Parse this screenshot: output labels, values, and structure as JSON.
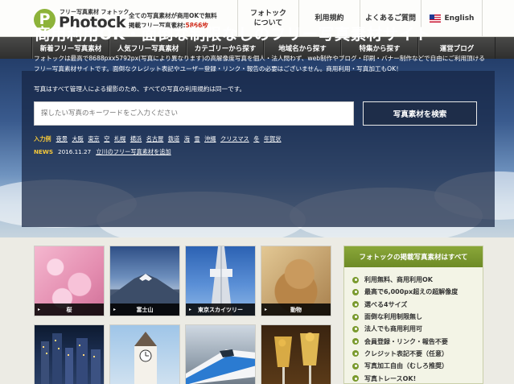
{
  "header": {
    "logo_letter": "P",
    "logo_small": "フリー写真素材 フォトック",
    "logo_word": "Photock",
    "tagline_1": "全ての写真素材が商用OKで無料",
    "tagline_2_prefix": "掲載フリー写真素材:",
    "tagline_2_count": "5866枚",
    "links": [
      {
        "label_1": "フォトック",
        "label_2": "について"
      },
      {
        "label_1": "利用規約",
        "label_2": ""
      },
      {
        "label_1": "よくあるご質問",
        "label_2": ""
      }
    ],
    "language": {
      "label": "English",
      "icon": "us-flag-icon"
    }
  },
  "nav": {
    "items": [
      "新着フリー写真素材",
      "人気フリー写真素材",
      "カテゴリーから探す",
      "地域名から探す",
      "特集から探す",
      "運営ブログ"
    ]
  },
  "hero": {
    "title": "商用利用OK・面倒な制限なしのフリー写真素材サイト",
    "description": "フォトックは最高で8688pxx5792px(写真により異なります)の高解像度写真を個人・法人問わず、web制作やブログ・印刷・バナー制作などで自由にご利用頂けるフリー写真素材サイトです。面倒なクレジット表記やユーザー登録・リンク・報告の必要はございません。商用利用・写真加工もOK！",
    "description_2": "写真はすべて管理人による撮影のため、すべての写真の利用規約は同一です。",
    "search_placeholder": "探したい写真のキーワードをご入力ください",
    "search_button": "写真素材を検索",
    "examples_label": "入力例",
    "examples": [
      "夜景",
      "大阪",
      "東京",
      "空",
      "札幌",
      "横浜",
      "名古屋",
      "鉄道",
      "海",
      "雪",
      "沖縄",
      "クリスマス",
      "冬",
      "年賀状"
    ],
    "news_label": "NEWS",
    "news_date": "2016.11.27",
    "news_text": "立川のフリー写真素材を追加"
  },
  "thumbnails": [
    {
      "caption": "桜"
    },
    {
      "caption": "富士山"
    },
    {
      "caption": "東京スカイツリー"
    },
    {
      "caption": "動物"
    },
    {
      "caption": ""
    },
    {
      "caption": ""
    },
    {
      "caption": ""
    },
    {
      "caption": ""
    }
  ],
  "sidebar": {
    "title": "フォトックの掲載写真素材はすべて",
    "items": [
      "利用無料、商用利用OK",
      "最高で6,000px超えの超解像度",
      "選べる4サイズ",
      "面倒な利用制限無し",
      "法人でも商用利用可",
      "会員登録・リンク・報告不要",
      "クレジット表記不要（任意）",
      "写真加工自由（むしろ推奨）",
      "写真トレースOK!"
    ]
  },
  "colors": {
    "brand_green": "#8db33a",
    "accent_red": "#d02a1a",
    "nav_bg": "#3a3a38",
    "hero_label_yellow": "#f7c93a"
  }
}
